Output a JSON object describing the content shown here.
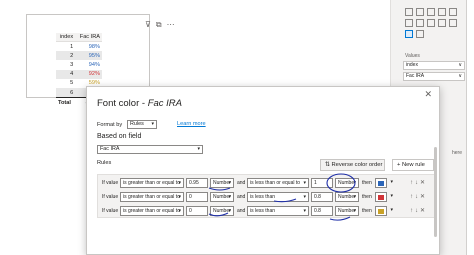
{
  "visual": {
    "toolbar": [
      "⊽",
      "⧉",
      "⋯"
    ],
    "table": {
      "headers": [
        "index",
        "Fac IRA"
      ],
      "rows": [
        {
          "index": "1",
          "value": "98%",
          "color": "#2b65b8"
        },
        {
          "index": "2",
          "value": "95%",
          "color": "#2b65b8"
        },
        {
          "index": "3",
          "value": "94%",
          "color": "#2b65b8"
        },
        {
          "index": "4",
          "value": "92%",
          "color": "#d13438"
        },
        {
          "index": "5",
          "value": "59%",
          "color": "#c9a227"
        },
        {
          "index": "6",
          "value": "57%",
          "color": "#c9a227"
        }
      ],
      "total": {
        "label": "Total",
        "value": "475%"
      }
    }
  },
  "right_pane": {
    "values_label": "Values",
    "wells": [
      "index",
      "Fac IRA"
    ],
    "side_text": "here"
  },
  "dialog": {
    "title_prefix": "Font color - ",
    "title_measure": "Fac IRA",
    "format_by_label": "Format by",
    "format_by_value": "Rules",
    "learn_more": "Learn more",
    "based_on_label": "Based on field",
    "based_on_value": "Fac IRA",
    "rules_label": "Rules",
    "reverse_button": "Reverse color order",
    "new_rule_button": "+ New rule",
    "rules": [
      {
        "if": "If value",
        "op1": "is greater than or equal to",
        "v1": "0.95",
        "t1": "Number",
        "and": "and",
        "op2": "is less than or equal to",
        "v2": "1",
        "t2": "Number",
        "then": "then",
        "color": "#2b65b8"
      },
      {
        "if": "If value",
        "op1": "is greater than or equal to",
        "v1": "0",
        "t1": "Number",
        "and": "and",
        "op2": "is less than",
        "v2": "0.8",
        "t2": "Number",
        "then": "then",
        "color": "#d13438"
      },
      {
        "if": "If value",
        "op1": "is greater than or equal to",
        "v1": "0",
        "t1": "Number",
        "and": "and",
        "op2": "is less than",
        "v2": "0.8",
        "t2": "Number",
        "then": "then",
        "color": "#c9a227"
      }
    ]
  }
}
